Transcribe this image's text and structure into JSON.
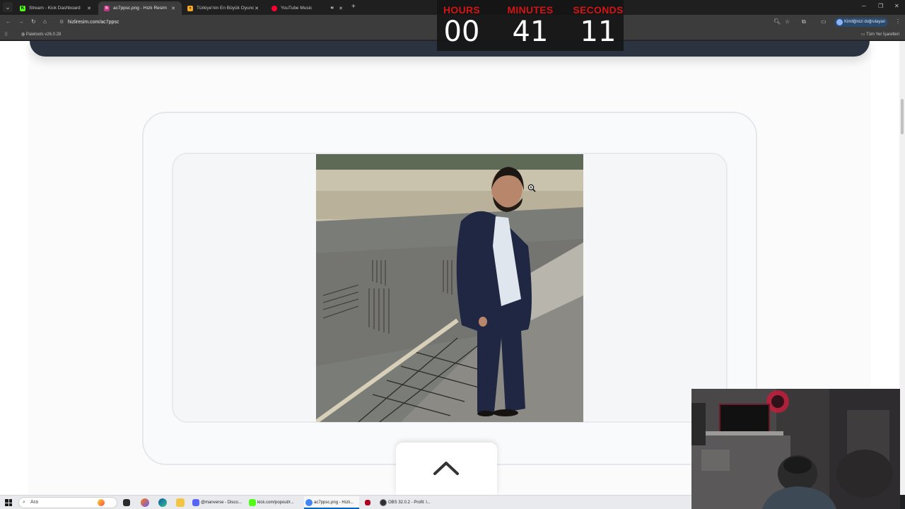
{
  "browser": {
    "tabs": [
      {
        "title": "Stream - Kick Dashboard",
        "active": false,
        "favicon": "kick-icon"
      },
      {
        "title": "ac7ppsc.png - Hızlı Resim",
        "active": true,
        "favicon": "hizliresim-icon"
      },
      {
        "title": "Türkiye'nin En Büyük Oyuncu D",
        "active": false,
        "favicon": "site-icon"
      },
      {
        "title": "YouTube Music",
        "active": false,
        "favicon": "youtube-music-icon",
        "audio": true
      }
    ],
    "url": "hizliresim.com/ac7ppsc",
    "profile_label": "Kimliğinizi doğrulayan",
    "bookmarks": [
      {
        "label": "Paletools v26.0.28"
      }
    ],
    "all_bookmarks_label": "Tüm Yer İşaretleri"
  },
  "countdown": {
    "hours_label": "HOURS",
    "hours": "00",
    "minutes_label": "MINUTES",
    "minutes": "41",
    "seconds_label": "SECONDS",
    "seconds": "11"
  },
  "taskbar": {
    "search_placeholder": "Ara",
    "tasks": [
      {
        "label": "@manverse - Disco...",
        "icon": "discord-icon",
        "color": "#5865f2"
      },
      {
        "label": "kick.com/popout/r...",
        "icon": "kick-icon",
        "color": "#53fc18"
      },
      {
        "label": "ac7ppsc.png - Hızlı...",
        "icon": "chrome-icon",
        "color": "#4285f4"
      },
      {
        "label": "OBS 32.0.2 - Profil: l...",
        "icon": "obs-icon",
        "color": "#302e31"
      }
    ]
  },
  "colors": {
    "countdown_label": "#d41414",
    "header_strip": "#2b3240"
  }
}
